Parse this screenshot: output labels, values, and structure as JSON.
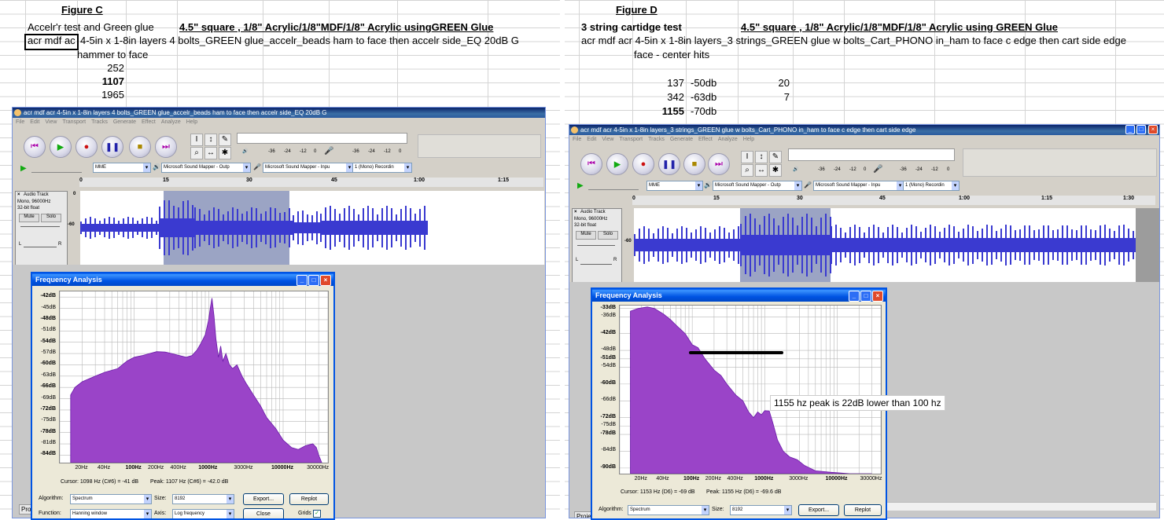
{
  "left": {
    "figure_label": "Figure C",
    "row1_a": "Accelr'r test and Green glue",
    "row1_b": "4.5\" square , 1/8\" Acrylic/1/8\"MDF/1/8\" Acrylic  usingGREEN Glue",
    "row2_selected": "acr mdf ac",
    "row2_rest": "4-5in x 1-8in layers 4 bolts_GREEN glue_accelr_beads ham to face then accelr side_EQ 20dB G",
    "row3": "hammer to face",
    "values": [
      "252",
      "1107",
      "1965"
    ],
    "audacity": {
      "title": "acr mdf acr 4-5in x 1-8in layers 4 bolts_GREEN glue_accelr_beads ham to face then accelr side_EQ 20dB G",
      "menus": [
        "File",
        "Edit",
        "View",
        "Transport",
        "Tracks",
        "Generate",
        "Effect",
        "Analyze",
        "Help"
      ],
      "meter_labels": [
        "-36",
        "-24",
        "-12",
        "0"
      ],
      "host": "MME",
      "output_device": "Microsoft Sound Mapper - Outp",
      "input_device": "Microsoft Sound Mapper - Inpu",
      "channels": "1 (Mono) Recordin",
      "ruler": [
        "0",
        "15",
        "30",
        "45",
        "1:00",
        "1:15"
      ],
      "track_name": "Audio Track",
      "track_info": [
        "Mono, 96000Hz",
        "32-bit float"
      ],
      "mute": "Mute",
      "solo": "Solo",
      "scale_top": "0",
      "scale_mid": "-60",
      "pan_l": "L",
      "pan_r": "R",
      "proj": "Proj"
    },
    "freq": {
      "title": "Frequency Analysis",
      "ylabels": [
        "-42dB",
        "-45dB",
        "-48dB",
        "-51dB",
        "-54dB",
        "-57dB",
        "-60dB",
        "-63dB",
        "-66dB",
        "-69dB",
        "-72dB",
        "-75dB",
        "-78dB",
        "-81dB",
        "-84dB"
      ],
      "xlabels": [
        "20Hz",
        "40Hz",
        "100Hz",
        "200Hz",
        "400Hz",
        "1000Hz",
        "3000Hz",
        "10000Hz",
        "30000Hz"
      ],
      "cursor": "Cursor: 1098 Hz (C#6) = -41 dB",
      "peak": "Peak: 1107 Hz (C#6) = -42.0 dB",
      "algorithm_label": "Algorithm:",
      "algorithm": "Spectrum",
      "size_label": "Size:",
      "size": "8192",
      "function_label": "Function:",
      "function": "Hanning window",
      "axis_label": "Axis:",
      "axis": "Log frequency",
      "export": "Export...",
      "replot": "Replot",
      "close": "Close",
      "grids": "Grids"
    }
  },
  "right": {
    "figure_label": "Figure D",
    "row1_a": "3 string cartidge test",
    "row1_b": "4.5\" square , 1/8\" Acrylic/1/8\"MDF/1/8\" Acrylic  using GREEN Glue",
    "row2": "acr mdf acr 4-5in x 1-8in layers_3 strings_GREEN glue w bolts_Cart_PHONO in_ham to face c edge then cart side edge",
    "row3": "face - center hits",
    "table": [
      {
        "hz": "137",
        "db": "-50db",
        "n": "20"
      },
      {
        "hz": "342",
        "db": "-63db",
        "n": "7"
      },
      {
        "hz": "1155",
        "db": "-70db",
        "n": ""
      }
    ],
    "audacity": {
      "title": "acr mdf acr 4-5in x 1-8in layers_3 strings_GREEN glue w bolts_Cart_PHONO in_ham to face c edge then cart side edge",
      "menus": [
        "File",
        "Edit",
        "View",
        "Transport",
        "Tracks",
        "Generate",
        "Effect",
        "Analyze",
        "Help"
      ],
      "meter_labels": [
        "-36",
        "-24",
        "-12",
        "0"
      ],
      "host": "MME",
      "output_device": "Microsoft Sound Mapper - Outp",
      "input_device": "Microsoft Sound Mapper - Inpu",
      "channels": "1 (Mono) Recordin",
      "ruler": [
        "0",
        "15",
        "30",
        "45",
        "1:00",
        "1:15",
        "1:30"
      ],
      "track_name": "Audio Track",
      "track_info": [
        "Mono, 96000Hz",
        "32-bit float"
      ],
      "mute": "Mute",
      "solo": "Solo",
      "scale_top": "0",
      "scale_mid": "-60",
      "pan_l": "L",
      "pan_r": "R",
      "proj": "Proje"
    },
    "freq": {
      "title": "Frequency Analysis",
      "ylabels": [
        "-33dB",
        "-36dB",
        "-42dB",
        "-48dB",
        "-51dB",
        "-54dB",
        "-60dB",
        "-66dB",
        "-72dB",
        "-75dB",
        "-78dB",
        "-84dB",
        "-90dB"
      ],
      "xlabels": [
        "20Hz",
        "40Hz",
        "100Hz",
        "200Hz",
        "400Hz",
        "1000Hz",
        "3000Hz",
        "10000Hz",
        "30000Hz"
      ],
      "cursor": "Cursor: 1153 Hz (D6) = -69 dB",
      "peak": "Peak: 1155 Hz (D6) = -69.6 dB",
      "algorithm_label": "Algorithm:",
      "algorithm": "Spectrum",
      "size_label": "Size:",
      "size": "8192",
      "export": "Export...",
      "replot": "Replot",
      "callout": "1155 hz peak is 22dB lower than 100 hz"
    }
  },
  "colors": {
    "spectrum_fill": "#9a44c8",
    "waveform": "#3a3ad0",
    "titlebar": "#0054e3",
    "grid": "#d4d4d4"
  }
}
